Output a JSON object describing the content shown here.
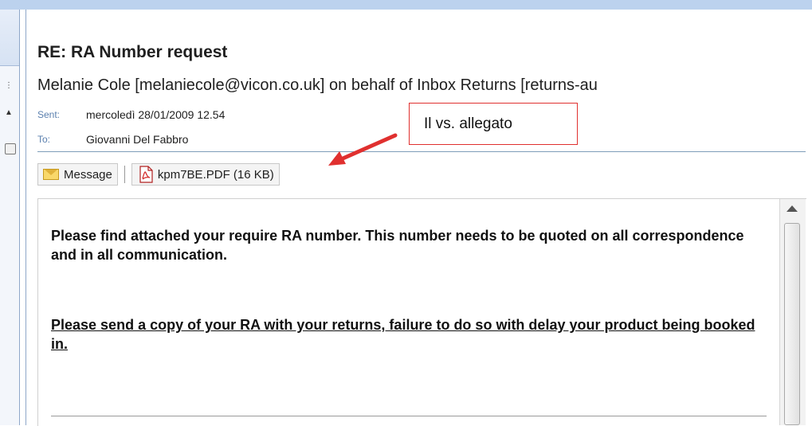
{
  "message": {
    "subject": "RE: RA Number request",
    "from": "Melanie Cole [melaniecole@vicon.co.uk] on behalf of Inbox Returns [returns-au",
    "sent_label": "Sent:",
    "sent_value": "mercoledì 28/01/2009 12.54",
    "to_label": "To:",
    "to_value": "Giovanni Del Fabbro"
  },
  "attachments": {
    "message_tab": "Message",
    "file": "kpm7BE.PDF (16 KB)"
  },
  "body": {
    "paragraph1": "Please find attached your require RA number. This number needs to be quoted on all correspondence and in all communication.",
    "paragraph2": "Please send a copy of your RA with your returns, failure to do so with delay your product being booked in."
  },
  "annotation": {
    "callout_text": "Il vs. allegato",
    "color": "#e0302f"
  },
  "icons": {
    "message": "envelope-icon",
    "attachment": "pdf-icon",
    "scroll": "scroll-up-arrow-icon"
  }
}
